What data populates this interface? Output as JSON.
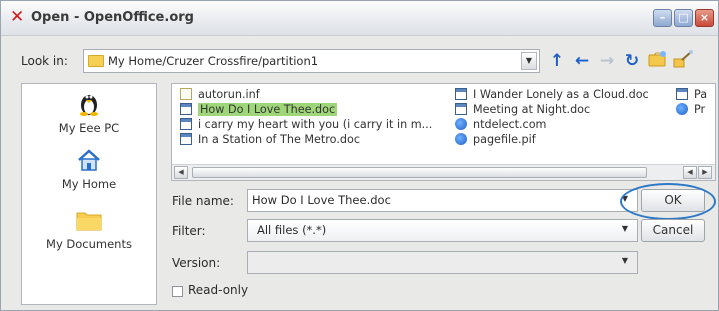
{
  "window": {
    "title": "Open - OpenOffice.org",
    "app_icon": "openoffice-x-icon",
    "controls": [
      "minimize",
      "maximize",
      "close"
    ]
  },
  "look_in": {
    "label": "Look in:",
    "path": "My Home/Cruzer Crossfire/partition1",
    "toolbar_icons": [
      "up-arrow-icon",
      "back-arrow-icon",
      "forward-arrow-icon",
      "refresh-icon",
      "new-folder-icon",
      "view-options-icon"
    ]
  },
  "places": [
    {
      "label": "My Eee PC",
      "icon": "penguin-icon"
    },
    {
      "label": "My Home",
      "icon": "home-icon"
    },
    {
      "label": "My Documents",
      "icon": "folder-icon"
    }
  ],
  "files": {
    "column1": [
      {
        "name": "autorun.inf",
        "type": "inf"
      },
      {
        "name": "How Do I Love Thee.doc",
        "type": "doc",
        "selected": true
      },
      {
        "name": "i carry my heart with you (i carry it in m...",
        "type": "doc"
      },
      {
        "name": "In a Station of The Metro.doc",
        "type": "doc"
      }
    ],
    "column2": [
      {
        "name": "I Wander Lonely as a Cloud.doc",
        "type": "doc"
      },
      {
        "name": "Meeting at Night.doc",
        "type": "doc"
      },
      {
        "name": "ntdelect.com",
        "type": "com"
      },
      {
        "name": "pagefile.pif",
        "type": "com"
      }
    ],
    "column3": [
      {
        "name": "Pa",
        "type": "doc"
      },
      {
        "name": "Pr",
        "type": "com"
      }
    ]
  },
  "form": {
    "file_name_label": "File name:",
    "file_name_value": "How Do I Love Thee.doc",
    "filter_label": "Filter:",
    "filter_value": "All files (*.*)",
    "version_label": "Version:",
    "version_value": "",
    "read_only_label": "Read-only",
    "read_only_checked": false
  },
  "buttons": {
    "ok": "OK",
    "cancel": "Cancel"
  },
  "colors": {
    "selection": "#9fd67a",
    "highlight_ring": "#2d79c7",
    "title_x": "#d11a1a"
  }
}
